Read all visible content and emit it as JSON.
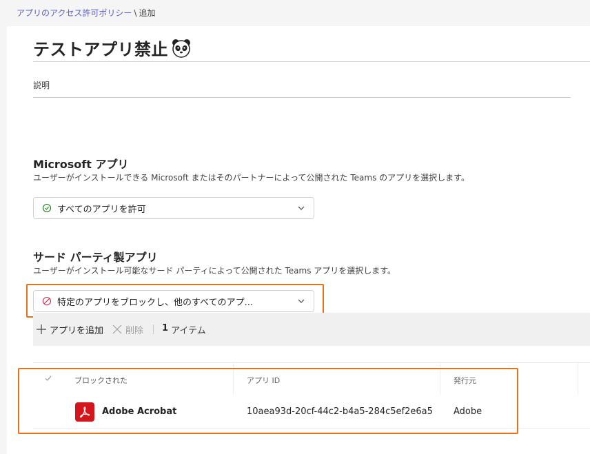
{
  "breadcrumb": {
    "parent": "アプリのアクセス許可ポリシー",
    "separator": "\\",
    "current": "追加"
  },
  "title": "テストアプリ禁止",
  "title_icon": "panda-icon",
  "description_label": "説明",
  "microsoft_apps": {
    "heading": "Microsoft アプリ",
    "subtext": "ユーザーがインストールできる Microsoft またはそのパートナーによって公開された Teams のアプリを選択します。",
    "selected": "すべてのアプリを許可",
    "icon": "check-circle-icon"
  },
  "third_party_apps": {
    "heading": "サード パーティ製アプリ",
    "subtext": "ユーザーがインストール可能なサード パーティによって公開された Teams アプリを選択します。",
    "selected": "特定のアプリをブロックし、他のすべてのアプ...",
    "icon": "block-icon"
  },
  "toolbar": {
    "add_label": "アプリを追加",
    "delete_label": "削除",
    "count_number": "1",
    "count_label": "アイテム"
  },
  "table": {
    "headers": {
      "blocked": "ブロックされた",
      "app_id": "アプリ ID",
      "publisher": "発行元"
    },
    "rows": [
      {
        "name": "Adobe Acrobat",
        "app_id": "10aea93d-20cf-44c2-b4a5-284c5ef2e6a5",
        "publisher": "Adobe",
        "logo_icon": "adobe-acrobat-icon"
      }
    ]
  },
  "colors": {
    "accent": "#5b5fc7",
    "highlight": "#e8711a",
    "allow": "#107c10",
    "block": "#c4314b",
    "adobe_red": "#d4151c"
  }
}
